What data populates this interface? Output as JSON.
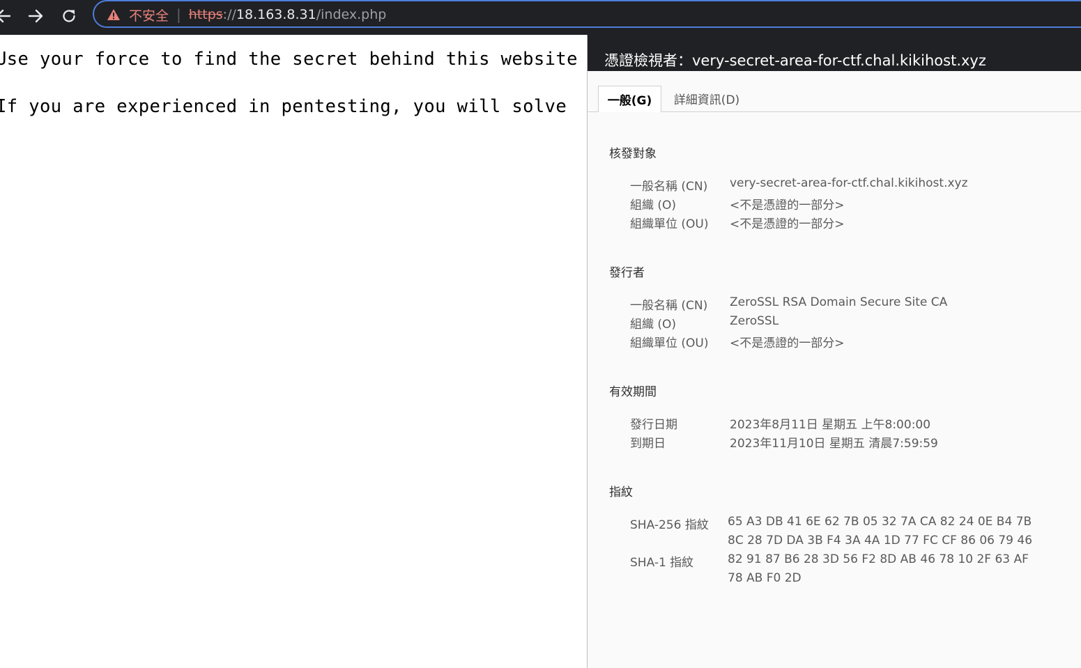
{
  "browser": {
    "back_icon": "arrow-left-icon",
    "forward_icon": "arrow-right-icon",
    "reload_icon": "reload-icon",
    "warning_icon": "warning-triangle-icon",
    "security_label": "不安全",
    "separator": "|",
    "url_scheme": "https",
    "url_slashes": "://",
    "url_host": "18.163.8.31",
    "url_path": "/index.php",
    "colors": {
      "toolbar_bg": "#202124",
      "omnibox_border": "#4d7fdc",
      "insecure_red": "#e8817b"
    }
  },
  "page": {
    "line1": "Use your force to find the secret behind this website",
    "line2": "If you are experienced in pentesting, you will solve"
  },
  "cert_viewer": {
    "title": "憑證檢視者：very-secret-area-for-ctf.chal.kikihost.xyz",
    "tabs": [
      {
        "label": "一般(G)",
        "active": true
      },
      {
        "label": "詳細資訊(D)",
        "active": false
      }
    ],
    "issued_to": {
      "title": "核發對象",
      "rows": [
        {
          "label": "一般名稱 (CN)",
          "value": "very-secret-area-for-ctf.chal.kikihost.xyz"
        },
        {
          "label": "組織 (O)",
          "value": "<不是憑證的一部分>"
        },
        {
          "label": "組織單位 (OU)",
          "value": "<不是憑證的一部分>"
        }
      ]
    },
    "issued_by": {
      "title": "發行者",
      "rows": [
        {
          "label": "一般名稱 (CN)",
          "value": "ZeroSSL RSA Domain Secure Site CA"
        },
        {
          "label": "組織 (O)",
          "value": "ZeroSSL"
        },
        {
          "label": "組織單位 (OU)",
          "value": "<不是憑證的一部分>"
        }
      ]
    },
    "validity": {
      "title": "有效期間",
      "rows": [
        {
          "label": "發行日期",
          "value": "2023年8月11日 星期五 上午8:00:00"
        },
        {
          "label": "到期日",
          "value": "2023年11月10日 星期五 清晨7:59:59"
        }
      ]
    },
    "fingerprints": {
      "title": "指紋",
      "sha256_label": "SHA-256 指紋",
      "sha256_line1": "65 A3 DB 41 6E 62 7B 05 32 7A CA 82 24 0E B4 7B",
      "sha256_line2": "8C 28 7D DA 3B F4 3A 4A 1D 77 FC CF 86 06 79 46",
      "sha1_label": "SHA-1 指紋",
      "sha1_line1": "82 91 87 B6 28 3D 56 F2 8D AB 46 78 10 2F 63 AF",
      "sha1_line2": "78 AB F0 2D"
    }
  }
}
